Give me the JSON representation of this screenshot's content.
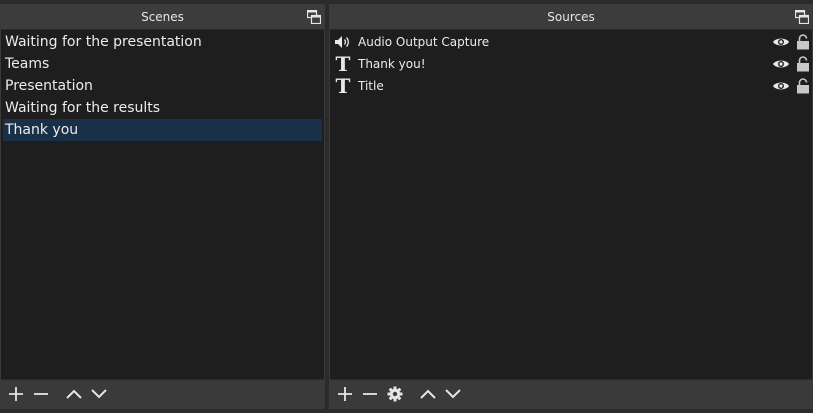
{
  "scenes": {
    "title": "Scenes",
    "items": [
      {
        "label": "Waiting for the presentation",
        "selected": false
      },
      {
        "label": "Teams",
        "selected": false
      },
      {
        "label": "Presentation",
        "selected": false
      },
      {
        "label": "Waiting for the results",
        "selected": false
      },
      {
        "label": "Thank you",
        "selected": true
      }
    ],
    "toolbar": [
      "add-icon",
      "remove-icon",
      "move-up-icon",
      "move-down-icon"
    ]
  },
  "sources": {
    "title": "Sources",
    "items": [
      {
        "label": "Audio Output Capture",
        "icon": "speaker-icon",
        "visible": true,
        "locked": false
      },
      {
        "label": "Thank you!",
        "icon": "text-icon",
        "visible": true,
        "locked": false
      },
      {
        "label": "Title",
        "icon": "text-icon",
        "visible": true,
        "locked": false
      }
    ],
    "toolbar": [
      "add-icon",
      "remove-icon",
      "gear-icon",
      "move-up-icon",
      "move-down-icon"
    ]
  },
  "colors": {
    "panel_bg": "#1e1e1e",
    "title_bg": "#3c3c3c",
    "toolbar_bg": "#3a3a3a",
    "selection": "#193048",
    "text": "#ececec"
  }
}
